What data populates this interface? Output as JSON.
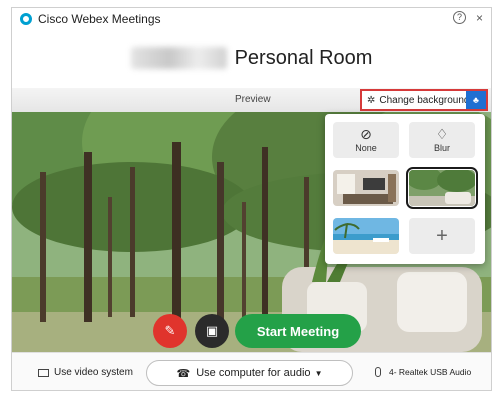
{
  "app": {
    "title": "Cisco Webex Meetings",
    "help_glyph": "?",
    "close_glyph": "×"
  },
  "room": {
    "title": "Personal Room"
  },
  "preview": {
    "label": "Preview",
    "change_background_label": "Change background"
  },
  "background_options": {
    "none_label": "None",
    "blur_label": "Blur",
    "add_glyph": "+"
  },
  "controls": {
    "start_meeting_label": "Start Meeting",
    "mute_state": "muted",
    "camera_state": "off"
  },
  "footer": {
    "video_system_label": "Use video system",
    "audio_label": "Use computer for audio",
    "microphone_label": "4- Realtek USB Audio"
  },
  "colors": {
    "accent_blue": "#1f6fd1",
    "start_green": "#24a148",
    "mute_red": "#e0342c",
    "highlight_red": "#d63a3a"
  }
}
